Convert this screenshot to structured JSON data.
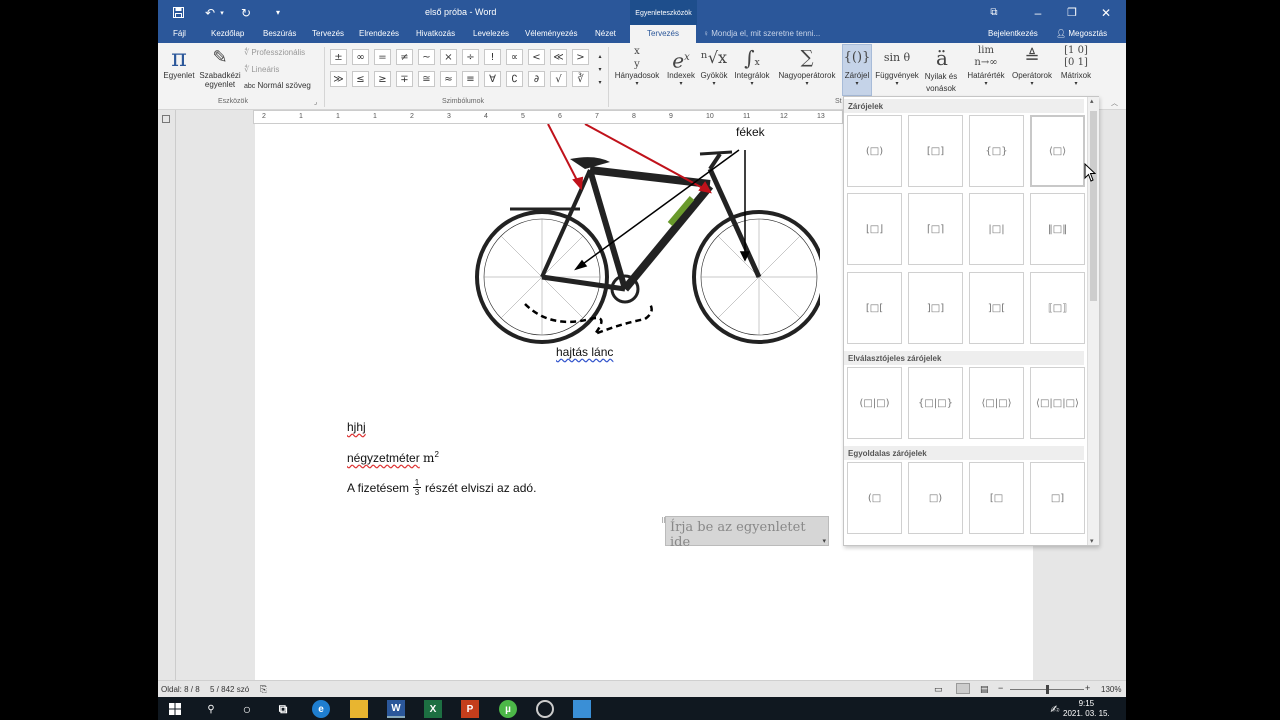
{
  "window": {
    "title": "első próba - Word",
    "context_tab_group": "Egyenleteszközök"
  },
  "tabs": [
    {
      "label": "Fájl"
    },
    {
      "label": "Kezdőlap"
    },
    {
      "label": "Beszúrás"
    },
    {
      "label": "Tervezés"
    },
    {
      "label": "Elrendezés"
    },
    {
      "label": "Hivatkozás"
    },
    {
      "label": "Levelezés"
    },
    {
      "label": "Véleményezés"
    },
    {
      "label": "Nézet"
    },
    {
      "label": "Tervezés",
      "active": true
    }
  ],
  "tell_me": "Mondja el, mit szeretne tenni...",
  "signin": "Bejelentkezés",
  "share": "Megosztás",
  "ribbon": {
    "tools_group": {
      "label": "Eszközök",
      "equation": "Egyenlet",
      "ink_equation_line1": "Szabadkézi",
      "ink_equation_line2": "egyenlet",
      "professional": "Professzionális",
      "linear": "Lineáris",
      "normal_text": "Normál szöveg",
      "normal_text_prefix": "abc"
    },
    "symbols_group": {
      "label": "Szimbólumok",
      "row1": [
        "±",
        "∞",
        "=",
        "≠",
        "~",
        "×",
        "÷",
        "!",
        "∝",
        "<",
        "≪",
        ">"
      ],
      "row2": [
        "≫",
        "≤",
        "≥",
        "∓",
        "≅",
        "≈",
        "≡",
        "∀",
        "∁",
        "∂",
        "√",
        "∛"
      ]
    },
    "structures": [
      {
        "label": "Hányadosok",
        "glyph": "x/y"
      },
      {
        "label": "Indexek",
        "glyph": "eˣ"
      },
      {
        "label": "Gyökök",
        "glyph": "ⁿ√x"
      },
      {
        "label": "Integrálok",
        "glyph": "∫"
      },
      {
        "label": "Nagyoperátorok",
        "glyph": "∑"
      },
      {
        "label": "Zárójel",
        "glyph": "{()}"
      },
      {
        "label": "Függvények",
        "glyph": "sin θ"
      },
      {
        "label": "Nyilak és vonások",
        "glyph": "ä"
      },
      {
        "label": "Határérték",
        "glyph": "lim"
      },
      {
        "label": "Operátorok",
        "glyph": "≜"
      },
      {
        "label": "Mátrixok",
        "glyph": "[10/01]"
      }
    ],
    "structures_group_label": "St"
  },
  "document": {
    "image_labels": {
      "brakes": "fékek",
      "drive": "hajtás lánc"
    },
    "lines": [
      {
        "text": "hjhj"
      },
      {
        "prefix": "négyzetméter",
        "unit": "m",
        "sup": "2"
      },
      {
        "before": "A fizetésem",
        "numerator": "1",
        "denominator": "3",
        "after": "részét elviszi az adó."
      }
    ],
    "equation_placeholder": "Írja be az egyenletet ide",
    "ruler_numbers": [
      "2",
      "1",
      "1",
      "1",
      "2",
      "3",
      "4",
      "5",
      "6",
      "7",
      "8",
      "9",
      "10",
      "11",
      "12",
      "13"
    ]
  },
  "gallery": {
    "sections": [
      {
        "title": "Zárójelek",
        "items": [
          "(□)",
          "[□]",
          "{□}",
          "⟨□⟩",
          "⌊□⌋",
          "⌈□⌉",
          "|□|",
          "‖□‖",
          "[□[",
          "]□]",
          "]□[",
          "⟦□⟧"
        ]
      },
      {
        "title": "Elválasztójeles zárójelek",
        "items": [
          "(□|□)",
          "{□|□}",
          "⟨□|□⟩",
          "⟨□|□|□⟩"
        ]
      },
      {
        "title": "Egyoldalas zárójelek",
        "items": [
          "(□",
          "□)",
          "[□",
          "□]"
        ]
      }
    ]
  },
  "status": {
    "page": "Oldal: 8 / 8",
    "words": "5 / 842 szó",
    "zoom": "130%"
  },
  "clock": {
    "time": "9:15",
    "date": "2021. 03. 15."
  },
  "colors": {
    "accent": "#2b579a",
    "ribbon": "#f3f3f3",
    "taskbar": "#101820"
  }
}
